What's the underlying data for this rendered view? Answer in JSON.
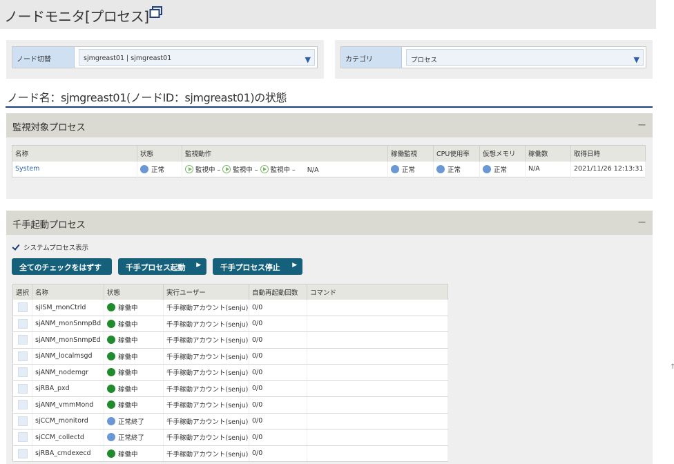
{
  "page": {
    "title": "ノードモニタ[プロセス]",
    "node_heading": "ノード名：sjmgreast01(ノードID：sjmgreast01)の状態"
  },
  "node_switch": {
    "label": "ノード切替",
    "value": "sjmgreast01 | sjmgreast01"
  },
  "category": {
    "label": "カテゴリ",
    "value": "プロセス"
  },
  "monitored": {
    "title": "監視対象プロセス",
    "collapse": "−",
    "columns": [
      "名称",
      "状態",
      "監視動作",
      "稼働監視",
      "CPU使用率",
      "仮想メモリ",
      "稼働数",
      "取得日時"
    ],
    "rows": [
      {
        "name": "System",
        "status": "正常",
        "actions": [
          "監視中",
          "監視中",
          "監視中"
        ],
        "dash": "–",
        "actions_extra": "N/A",
        "uptime": "正常",
        "cpu": "正常",
        "vmem": "正常",
        "count": "N/A",
        "timestamp": "2021/11/26 12:13:31"
      }
    ]
  },
  "manual": {
    "title": "千手起動プロセス",
    "collapse": "−",
    "checkbox_label": "システムプロセス表示",
    "buttons": {
      "uncheck_all": "全てのチェックをはずす",
      "start": "千手プロセス起動",
      "stop": "千手プロセス停止",
      "arrow": "▶"
    },
    "columns": [
      "選択",
      "名称",
      "状態",
      "実行ユーザー",
      "自動再起動回数",
      "コマンド"
    ],
    "rows": [
      {
        "name": "sjISM_monCtrld",
        "state": "稼働中",
        "state_color": "#1f8b2c",
        "user": "千手稼動アカウント(senju)",
        "restarts": "0/0",
        "command": ""
      },
      {
        "name": "sjANM_monSnmpBd",
        "state": "稼働中",
        "state_color": "#1f8b2c",
        "user": "千手稼動アカウント(senju)",
        "restarts": "0/0",
        "command": ""
      },
      {
        "name": "sjANM_monSnmpEd",
        "state": "稼働中",
        "state_color": "#1f8b2c",
        "user": "千手稼動アカウント(senju)",
        "restarts": "0/0",
        "command": ""
      },
      {
        "name": "sjANM_localmsgd",
        "state": "稼働中",
        "state_color": "#1f8b2c",
        "user": "千手稼動アカウント(senju)",
        "restarts": "0/0",
        "command": ""
      },
      {
        "name": "sjANM_nodemgr",
        "state": "稼働中",
        "state_color": "#1f8b2c",
        "user": "千手稼動アカウント(senju)",
        "restarts": "0/0",
        "command": ""
      },
      {
        "name": "sjRBA_pxd",
        "state": "稼働中",
        "state_color": "#1f8b2c",
        "user": "千手稼動アカウント(senju)",
        "restarts": "0/0",
        "command": ""
      },
      {
        "name": "sjANM_vmmMond",
        "state": "稼働中",
        "state_color": "#1f8b2c",
        "user": "千手稼動アカウント(senju)",
        "restarts": "0/0",
        "command": ""
      },
      {
        "name": "sjCCM_monitord",
        "state": "正常終了",
        "state_color": "#6a98d4",
        "user": "千手稼動アカウント(senju)",
        "restarts": "0/0",
        "command": ""
      },
      {
        "name": "sjCCM_collectd",
        "state": "正常終了",
        "state_color": "#6a98d4",
        "user": "千手稼動アカウント(senju)",
        "restarts": "0/0",
        "command": ""
      },
      {
        "name": "sjRBA_cmdexecd",
        "state": "稼働中",
        "state_color": "#1f8b2c",
        "user": "千手稼動アカウント(senju)",
        "restarts": "0/0",
        "command": ""
      }
    ]
  },
  "colors": {
    "header_bar": "#e8e8e8",
    "section_head": "#dadad3",
    "button": "#15607a",
    "heading_rule": "#1f3f7a",
    "status_normal": "#6a98d4",
    "status_running": "#1f8b2c"
  },
  "icons": {
    "title_icon": "window-restore-icon",
    "dropdown": "triangle-down-icon",
    "monitoring": "play-circle-icon"
  },
  "misc": {
    "scroll_glyph": "↑"
  }
}
